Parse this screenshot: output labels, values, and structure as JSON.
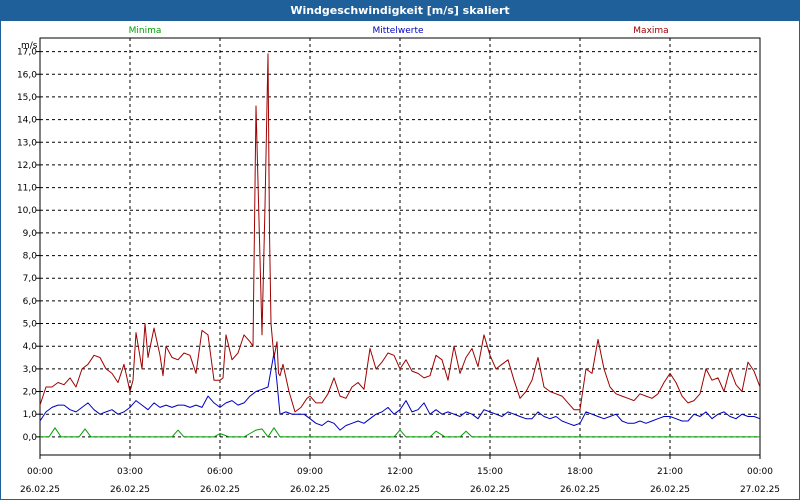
{
  "window": {
    "title": "Windgeschwindigkeit [m/s] skaliert"
  },
  "chart_data": {
    "type": "line",
    "title": "Windgeschwindigkeit [m/s] skaliert",
    "ylabel": "m/s",
    "xlabel": "",
    "ylim": [
      -0.8,
      17.6
    ],
    "xlim_hours": [
      0,
      24
    ],
    "grid": true,
    "legend_placement": "top",
    "y_ticks": [
      "0,0",
      "1,0",
      "2,0",
      "3,0",
      "4,0",
      "5,0",
      "6,0",
      "7,0",
      "8,0",
      "9,0",
      "10,0",
      "11,0",
      "12,0",
      "13,0",
      "14,0",
      "15,0",
      "16,0",
      "17,0"
    ],
    "x_ticks": [
      {
        "time": "00:00",
        "date": "26.02.25"
      },
      {
        "time": "03:00",
        "date": "26.02.25"
      },
      {
        "time": "06:00",
        "date": "26.02.25"
      },
      {
        "time": "09:00",
        "date": "26.02.25"
      },
      {
        "time": "12:00",
        "date": "26.02.25"
      },
      {
        "time": "15:00",
        "date": "26.02.25"
      },
      {
        "time": "18:00",
        "date": "26.02.25"
      },
      {
        "time": "21:00",
        "date": "26.02.25"
      },
      {
        "time": "00:00",
        "date": "27.02.25"
      }
    ],
    "series": [
      {
        "name": "Minima",
        "color": "#00a000",
        "x_hours": [
          0,
          0.3,
          0.5,
          0.7,
          1,
          1.3,
          1.5,
          1.7,
          2,
          3,
          4,
          4.4,
          4.6,
          4.8,
          5,
          5.5,
          5.8,
          6,
          6.3,
          6.5,
          6.8,
          7,
          7.2,
          7.4,
          7.6,
          7.8,
          8,
          8.3,
          9,
          10,
          11.8,
          12,
          12.2,
          12.5,
          13,
          13.2,
          13.5,
          14,
          14.2,
          14.4,
          14.6,
          15,
          18,
          24
        ],
        "values": [
          0,
          0,
          0.4,
          0,
          0,
          0,
          0.35,
          0,
          0,
          0,
          0,
          0,
          0.3,
          0,
          0,
          0,
          0,
          0.15,
          0,
          0,
          0,
          0.15,
          0.3,
          0.35,
          0,
          0.4,
          0,
          0,
          0,
          0,
          0,
          0.3,
          0,
          0,
          0,
          0.25,
          0,
          0,
          0.25,
          0,
          0,
          0,
          0,
          0
        ]
      },
      {
        "name": "Mittelwerte",
        "color": "#0000c0",
        "x_hours": [
          0,
          0.2,
          0.4,
          0.6,
          0.8,
          1,
          1.2,
          1.4,
          1.6,
          1.8,
          2,
          2.2,
          2.4,
          2.6,
          2.8,
          3,
          3.2,
          3.4,
          3.6,
          3.8,
          4,
          4.2,
          4.4,
          4.6,
          4.8,
          5,
          5.2,
          5.4,
          5.6,
          5.8,
          6,
          6.2,
          6.4,
          6.6,
          6.8,
          7,
          7.2,
          7.4,
          7.6,
          7.8,
          7.9,
          8,
          8.2,
          8.4,
          8.6,
          8.8,
          9,
          9.2,
          9.4,
          9.6,
          9.8,
          10,
          10.2,
          10.4,
          10.6,
          10.8,
          11,
          11.2,
          11.4,
          11.6,
          11.8,
          12,
          12.2,
          12.4,
          12.6,
          12.8,
          13,
          13.2,
          13.4,
          13.6,
          13.8,
          14,
          14.2,
          14.4,
          14.6,
          14.8,
          15,
          15.2,
          15.4,
          15.6,
          15.8,
          16,
          16.2,
          16.4,
          16.6,
          16.8,
          17,
          17.2,
          17.4,
          17.6,
          17.8,
          18,
          18.2,
          18.4,
          18.6,
          18.8,
          19,
          19.2,
          19.4,
          19.6,
          19.8,
          20,
          20.2,
          20.4,
          20.6,
          20.8,
          21,
          21.2,
          21.4,
          21.6,
          21.8,
          22,
          22.2,
          22.4,
          22.6,
          22.8,
          23,
          23.2,
          23.4,
          23.6,
          23.8,
          24
        ],
        "values": [
          0.7,
          1.1,
          1.3,
          1.4,
          1.4,
          1.2,
          1.1,
          1.3,
          1.5,
          1.2,
          1.0,
          1.1,
          1.2,
          1.0,
          1.1,
          1.3,
          1.6,
          1.4,
          1.2,
          1.5,
          1.3,
          1.4,
          1.3,
          1.4,
          1.4,
          1.3,
          1.4,
          1.3,
          1.8,
          1.5,
          1.3,
          1.5,
          1.6,
          1.4,
          1.5,
          1.8,
          2.0,
          2.1,
          2.2,
          3.7,
          2.4,
          1.0,
          1.1,
          1.0,
          1.0,
          1.0,
          0.8,
          0.6,
          0.5,
          0.7,
          0.6,
          0.3,
          0.5,
          0.6,
          0.7,
          0.6,
          0.8,
          1.0,
          1.1,
          1.3,
          1.0,
          1.2,
          1.6,
          1.1,
          1.2,
          1.5,
          1.0,
          1.2,
          1.0,
          1.1,
          1.0,
          0.9,
          1.1,
          1.0,
          0.8,
          1.2,
          1.1,
          1.0,
          0.9,
          1.1,
          1.0,
          0.9,
          0.8,
          0.8,
          1.1,
          0.9,
          0.8,
          0.9,
          0.7,
          0.6,
          0.5,
          0.6,
          1.1,
          1.0,
          0.9,
          0.8,
          0.9,
          1.0,
          0.7,
          0.6,
          0.6,
          0.7,
          0.6,
          0.7,
          0.8,
          0.9,
          0.9,
          0.8,
          0.7,
          0.7,
          1.0,
          0.9,
          1.1,
          0.8,
          1.0,
          1.1,
          0.9,
          0.8,
          1.0,
          0.9,
          0.9,
          0.8,
          1.1,
          0.9
        ]
      },
      {
        "name": "Maxima",
        "color": "#a00000",
        "x_hours": [
          0,
          0.2,
          0.4,
          0.6,
          0.8,
          1,
          1.2,
          1.4,
          1.6,
          1.8,
          2,
          2.2,
          2.4,
          2.6,
          2.8,
          3,
          3.1,
          3.2,
          3.4,
          3.5,
          3.6,
          3.8,
          4,
          4.1,
          4.2,
          4.4,
          4.6,
          4.8,
          5,
          5.2,
          5.4,
          5.6,
          5.8,
          6,
          6.1,
          6.2,
          6.4,
          6.6,
          6.8,
          7,
          7.1,
          7.2,
          7.4,
          7.5,
          7.6,
          7.65,
          7.7,
          7.8,
          7.9,
          7.95,
          8,
          8.1,
          8.3,
          8.5,
          8.7,
          8.9,
          9,
          9.2,
          9.4,
          9.6,
          9.8,
          10,
          10.2,
          10.4,
          10.6,
          10.8,
          11,
          11.2,
          11.4,
          11.6,
          11.8,
          12,
          12.2,
          12.4,
          12.6,
          12.8,
          13,
          13.2,
          13.4,
          13.6,
          13.8,
          14,
          14.2,
          14.4,
          14.6,
          14.8,
          15,
          15.2,
          15.4,
          15.6,
          15.8,
          16,
          16.2,
          16.4,
          16.6,
          16.8,
          17,
          17.2,
          17.4,
          17.6,
          17.8,
          18,
          18.2,
          18.4,
          18.6,
          18.8,
          19,
          19.2,
          19.4,
          19.6,
          19.8,
          20,
          20.2,
          20.4,
          20.6,
          20.8,
          21,
          21.2,
          21.4,
          21.6,
          21.8,
          22,
          22.2,
          22.4,
          22.6,
          22.8,
          23,
          23.2,
          23.4,
          23.6,
          23.8,
          24
        ],
        "values": [
          1.4,
          2.2,
          2.2,
          2.4,
          2.3,
          2.6,
          2.2,
          3.0,
          3.2,
          3.6,
          3.5,
          3.0,
          2.8,
          2.4,
          3.2,
          2.0,
          2.5,
          4.6,
          3.0,
          5.0,
          3.5,
          4.8,
          3.6,
          2.7,
          4.0,
          3.5,
          3.4,
          3.7,
          3.6,
          2.8,
          4.7,
          4.5,
          2.5,
          2.5,
          2.6,
          4.5,
          3.4,
          3.7,
          4.5,
          4.2,
          4.0,
          14.6,
          4.5,
          10.2,
          16.9,
          9.0,
          5.0,
          3.5,
          4.2,
          2.8,
          2.7,
          3.2,
          2.0,
          1.1,
          1.3,
          1.7,
          1.8,
          1.5,
          1.5,
          1.9,
          2.6,
          1.8,
          1.7,
          2.2,
          2.4,
          2.1,
          3.9,
          3.0,
          3.3,
          3.7,
          3.6,
          3.0,
          3.4,
          2.9,
          2.8,
          2.6,
          2.7,
          3.6,
          3.4,
          2.5,
          4.0,
          2.8,
          3.5,
          3.9,
          3.1,
          4.5,
          3.6,
          3.0,
          3.2,
          3.4,
          2.5,
          1.7,
          2.0,
          2.5,
          3.5,
          2.2,
          2.0,
          1.9,
          1.8,
          1.5,
          1.2,
          1.2,
          3.0,
          2.8,
          4.3,
          3.0,
          2.2,
          1.9,
          1.8,
          1.7,
          1.6,
          1.9,
          1.8,
          1.7,
          1.9,
          2.4,
          2.8,
          2.4,
          1.8,
          1.5,
          1.6,
          1.9,
          3.0,
          2.5,
          2.6,
          2.0,
          3.0,
          2.3,
          2.0,
          3.3,
          2.9,
          2.2,
          2.9
        ]
      }
    ]
  }
}
